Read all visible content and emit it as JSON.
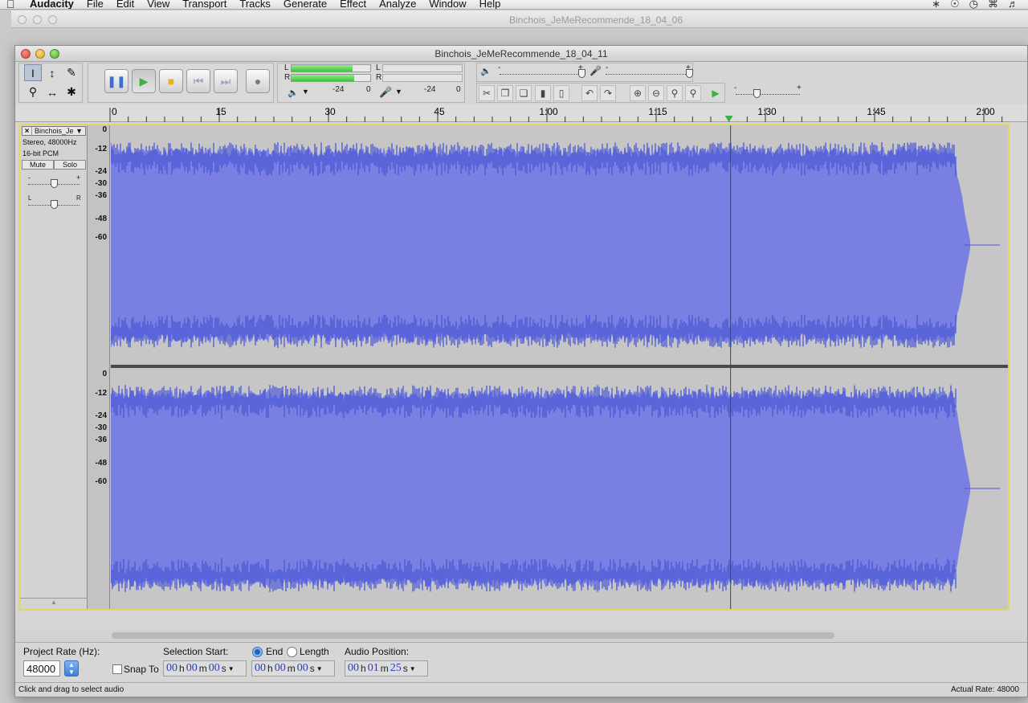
{
  "menubar": {
    "apple": "",
    "items": [
      "Audacity",
      "File",
      "Edit",
      "View",
      "Transport",
      "Tracks",
      "Generate",
      "Effect",
      "Analyze",
      "Window",
      "Help"
    ]
  },
  "background_window": {
    "title": "Binchois_JeMeRecommende_18_04_06"
  },
  "window": {
    "title": "Binchois_JeMeRecommende_18_04_11"
  },
  "meters": {
    "play_L": "L",
    "play_R": "R",
    "rec_L": "L",
    "rec_R": "R",
    "scale_a": "-24",
    "scale_b": "0",
    "scale_c": "-24",
    "scale_d": "0",
    "minus": "-",
    "plus": "+"
  },
  "ruler": {
    "ticks": [
      {
        "label": "0",
        "seconds": 0
      },
      {
        "label": "15",
        "seconds": 15
      },
      {
        "label": "30",
        "seconds": 30
      },
      {
        "label": "45",
        "seconds": 45
      },
      {
        "label": "1:00",
        "seconds": 60
      },
      {
        "label": "1:15",
        "seconds": 75
      },
      {
        "label": "1:30",
        "seconds": 90
      },
      {
        "label": "1:45",
        "seconds": 105
      },
      {
        "label": "2:00",
        "seconds": 120
      }
    ],
    "playhead_seconds": 85
  },
  "track": {
    "name": "Binchois_Je",
    "format": "Stereo, 48000Hz",
    "bit_depth": "16-bit PCM",
    "mute": "Mute",
    "solo": "Solo",
    "gain_minus": "-",
    "gain_plus": "+",
    "pan_left": "L",
    "pan_right": "R",
    "db_labels": [
      "0",
      "-12",
      "-24",
      "-30",
      "-36",
      "-48",
      "-60"
    ],
    "waveform_color": "#4b57d6",
    "waveform_fill": "#7a7fe2"
  },
  "selection_bar": {
    "project_rate_label": "Project Rate (Hz):",
    "project_rate": "48000",
    "snap_to": "Snap To",
    "selection_start_label": "Selection Start:",
    "end_label": "End",
    "length_label": "Length",
    "audio_position_label": "Audio Position:",
    "start_time": {
      "h": "00",
      "m": "00",
      "s": "00"
    },
    "end_time": {
      "h": "00",
      "m": "00",
      "s": "00"
    },
    "audio_position": {
      "h": "00",
      "m": "01",
      "s": "25"
    },
    "unit_h": "h",
    "unit_m": "m",
    "unit_s": "s"
  },
  "status": {
    "left": "Click and drag to select audio",
    "right": "Actual Rate: 48000"
  }
}
